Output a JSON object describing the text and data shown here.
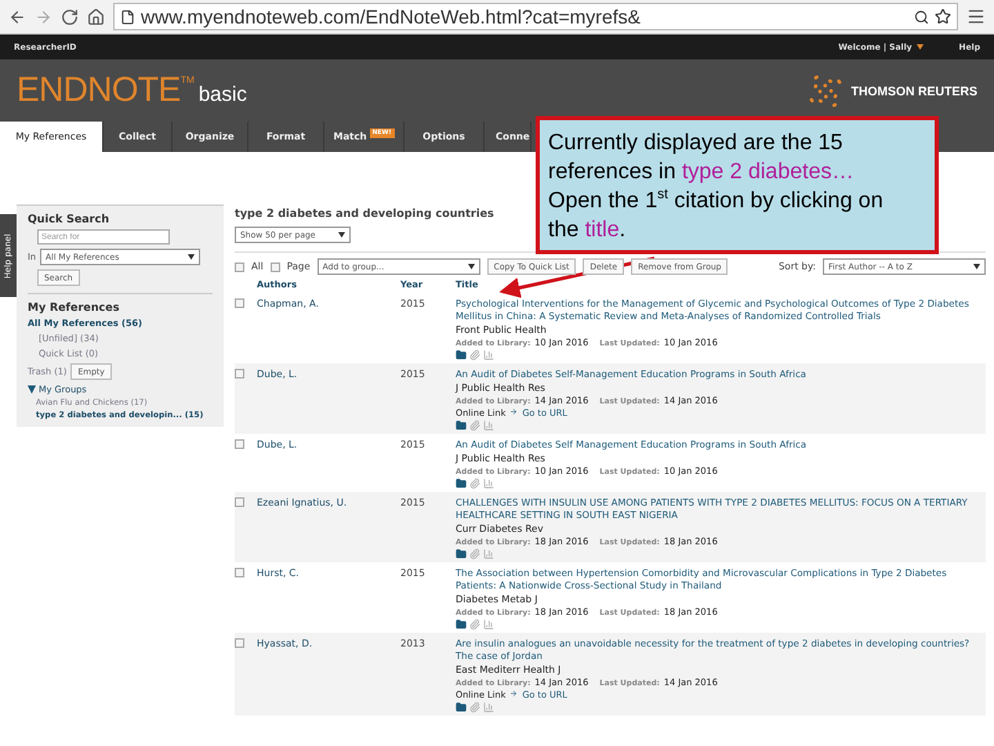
{
  "browser": {
    "url": "www.myendnoteweb.com/EndNoteWeb.html?cat=myrefs&"
  },
  "topbar": {
    "left": "ResearcherID",
    "welcome": "Welcome | Sally",
    "help": "Help"
  },
  "brand": {
    "name": "ENDNOTE",
    "tm": "TM",
    "edition": "basic",
    "partner": "THOMSON REUTERS"
  },
  "tabs": [
    {
      "label": "My References",
      "selected": true
    },
    {
      "label": "Collect",
      "selected": false
    },
    {
      "label": "Organize",
      "selected": false
    },
    {
      "label": "Format",
      "selected": false
    },
    {
      "label": "Match",
      "selected": false,
      "badge": "NEW!"
    },
    {
      "label": "Options",
      "selected": false
    },
    {
      "label": "Conne",
      "selected": false
    }
  ],
  "help_panel": "Help panel",
  "sidebar": {
    "quick_search": "Quick Search",
    "placeholder": "Search for",
    "in_label": "In",
    "scope": "All My References",
    "search_button": "Search",
    "my_references": "My References",
    "items": [
      {
        "label": "All My References (56)",
        "kind": "link"
      },
      {
        "label": "[Unfiled] (34)",
        "kind": "sub"
      },
      {
        "label": "Quick List (0)",
        "kind": "sub"
      },
      {
        "label": "Trash (1)",
        "kind": "trash",
        "button": "Empty"
      }
    ],
    "groups": {
      "label": "My Groups",
      "expanded": true,
      "children": [
        {
          "label": "Avian Flu and Chickens (17)",
          "selected": false
        },
        {
          "label": "type 2 diabetes and developin... (15)",
          "selected": true
        }
      ]
    }
  },
  "main": {
    "heading": "type 2 diabetes and developing countries",
    "per_page": "Show 50 per page",
    "toolbar": {
      "all": {
        "label": "All",
        "checked": false
      },
      "page": {
        "label": "Page",
        "checked": false
      },
      "add_group": "Add to group...",
      "buttons": [
        "Copy To Quick List",
        "Delete",
        "Remove from Group"
      ],
      "sort_label": "Sort by:",
      "sort_value": "First Author -- A to Z"
    },
    "columns": [
      "Authors",
      "Year",
      "Title"
    ],
    "rows": [
      {
        "checked": false,
        "author": "Chapman, A.",
        "year": "2015",
        "title": "Psychological Interventions for the Management of Glycemic and Psychological Outcomes of Type 2 Diabetes Mellitus in China: A Systematic Review and Meta-Analyses of Randomized Controlled Trials",
        "journal": "Front Public Health",
        "added_label": "Added to Library:",
        "added": "10 Jan 2016",
        "updated_label": "Last Updated:",
        "updated": "10 Jan 2016"
      },
      {
        "checked": false,
        "author": "Dube, L.",
        "year": "2015",
        "title": "An Audit of Diabetes Self-Management Education Programs in South Africa",
        "journal": "J Public Health Res",
        "added_label": "Added to Library:",
        "added": "14 Jan 2016",
        "updated_label": "Last Updated:",
        "updated": "14 Jan 2016",
        "online_label": "Online Link",
        "url_label": "Go to URL"
      },
      {
        "checked": false,
        "author": "Dube, L.",
        "year": "2015",
        "title": "An Audit of Diabetes Self Management Education Programs in South Africa",
        "journal": "J Public Health Res",
        "added_label": "Added to Library:",
        "added": "10 Jan 2016",
        "updated_label": "Last Updated:",
        "updated": "10 Jan 2016"
      },
      {
        "checked": false,
        "author": "Ezeani Ignatius, U.",
        "year": "2015",
        "title": "CHALLENGES WITH INSULIN USE AMONG PATIENTS WITH TYPE 2 DIABETES MELLITUS: FOCUS ON A TERTIARY HEALTHCARE SETTING IN SOUTH EAST NIGERIA",
        "journal": "Curr Diabetes Rev",
        "added_label": "Added to Library:",
        "added": "18 Jan 2016",
        "updated_label": "Last Updated:",
        "updated": "18 Jan 2016"
      },
      {
        "checked": false,
        "author": "Hurst, C.",
        "year": "2015",
        "title": "The Association between Hypertension Comorbidity and Microvascular Complications in Type 2 Diabetes Patients: A Nationwide Cross-Sectional Study in Thailand",
        "journal": "Diabetes Metab J",
        "added_label": "Added to Library:",
        "added": "18 Jan 2016",
        "updated_label": "Last Updated:",
        "updated": "18 Jan 2016"
      },
      {
        "checked": false,
        "author": "Hyassat, D.",
        "year": "2013",
        "title": "Are insulin analogues an unavoidable necessity for the treatment of type 2 diabetes in developing countries? The case of Jordan",
        "journal": "East Mediterr Health J",
        "added_label": "Added to Library:",
        "added": "14 Jan 2016",
        "updated_label": "Last Updated:",
        "updated": "14 Jan 2016",
        "online_label": "Online Link",
        "url_label": "Go to URL"
      }
    ]
  },
  "callout": {
    "parts": [
      {
        "kind": "plain",
        "text": "Currently displayed are the 15 references in "
      },
      {
        "kind": "highlight",
        "text": "type 2 diabetes…"
      },
      {
        "kind": "plain",
        "text": " Open the 1$^{st}$ citation by clicking on the "
      },
      {
        "kind": "highlight",
        "text": "title"
      },
      {
        "kind": "plain",
        "text": "."
      }
    ]
  }
}
